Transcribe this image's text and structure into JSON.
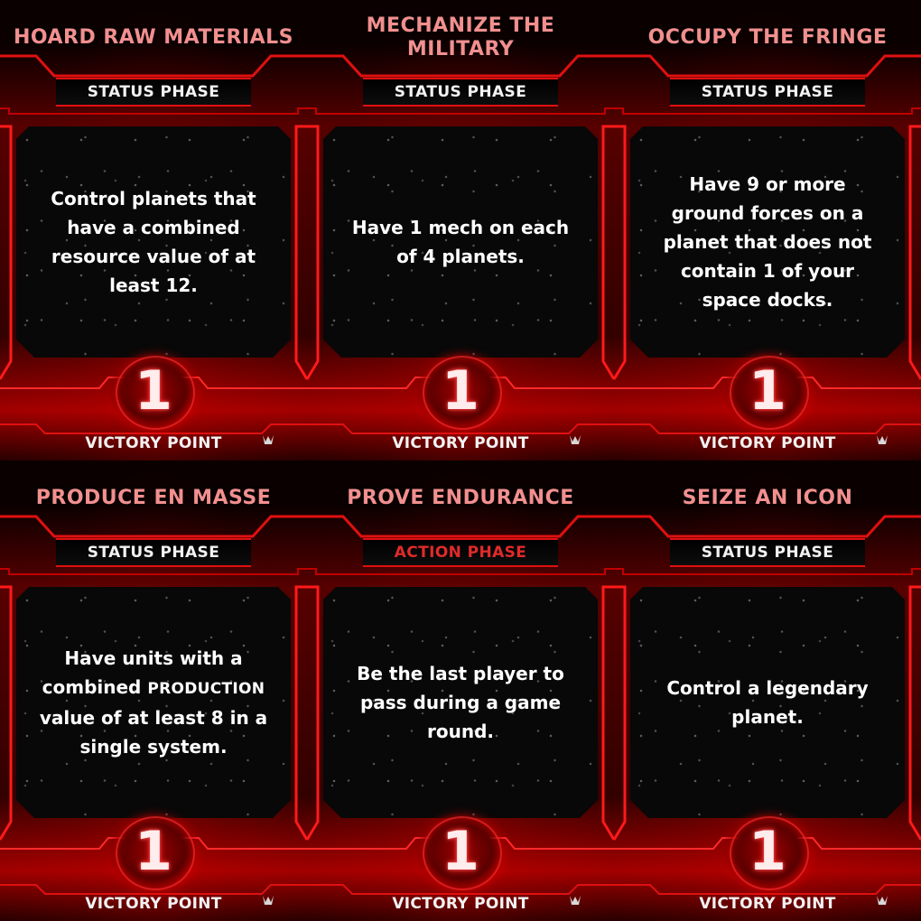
{
  "colors": {
    "title": "#f28f8f",
    "phase_status": "#f2f2f2",
    "phase_action": "#e02a2a",
    "frame_red": "#e01010",
    "panel": "#080808"
  },
  "icons": {
    "corner": "prophecy-of-kings-icon"
  },
  "cards": [
    {
      "title": "HOARD RAW MATERIALS",
      "phase": "STATUS PHASE",
      "phase_type": "status",
      "text": "Control planets that have a combined resource value of at least 12.",
      "points": "1",
      "points_label": "VICTORY POINT"
    },
    {
      "title": "MECHANIZE THE MILITARY",
      "phase": "STATUS PHASE",
      "phase_type": "status",
      "text": "Have 1 mech on each of 4 planets.",
      "points": "1",
      "points_label": "VICTORY POINT"
    },
    {
      "title": "OCCUPY THE FRINGE",
      "phase": "STATUS PHASE",
      "phase_type": "status",
      "text": "Have 9 or more ground forces on a planet that does not contain 1 of your space docks.",
      "points": "1",
      "points_label": "VICTORY POINT"
    },
    {
      "title": "PRODUCE EN MASSE",
      "phase": "STATUS PHASE",
      "phase_type": "status",
      "text_before": "Have units with a combined ",
      "text_keyword": "PRODUCTION",
      "text_after": " value of at least 8 in a single system.",
      "points": "1",
      "points_label": "VICTORY POINT"
    },
    {
      "title": "PROVE ENDURANCE",
      "phase": "ACTION PHASE",
      "phase_type": "action",
      "text": "Be the last player to pass during a game round.",
      "points": "1",
      "points_label": "VICTORY POINT"
    },
    {
      "title": "SEIZE AN ICON",
      "phase": "STATUS PHASE",
      "phase_type": "status",
      "text": "Control a legendary planet.",
      "points": "1",
      "points_label": "VICTORY POINT"
    }
  ]
}
